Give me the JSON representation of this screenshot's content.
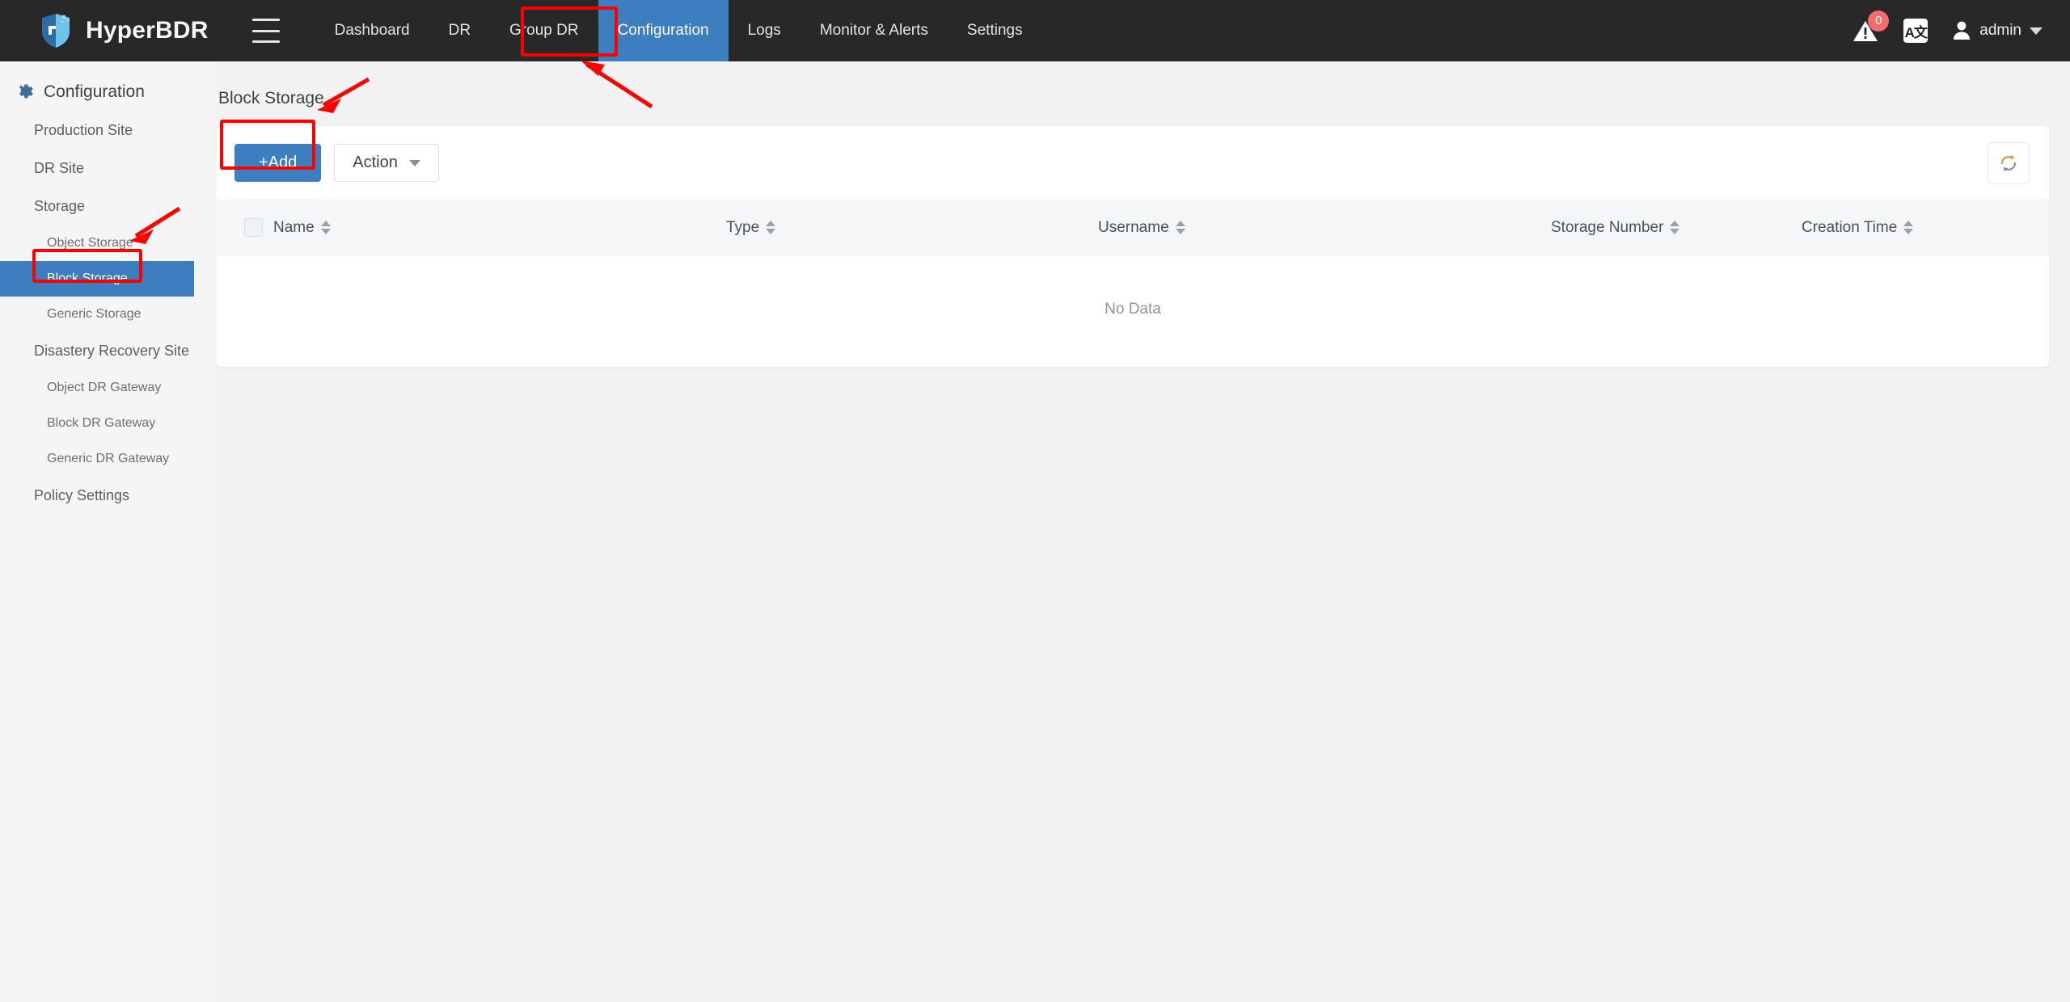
{
  "topbar": {
    "brand": "HyperBDR",
    "menu_icon": "hamburger-icon",
    "nav": [
      {
        "label": "Dashboard",
        "active": false
      },
      {
        "label": "DR",
        "active": false
      },
      {
        "label": "Group DR",
        "active": false
      },
      {
        "label": "Configuration",
        "active": true
      },
      {
        "label": "Logs",
        "active": false
      },
      {
        "label": "Monitor & Alerts",
        "active": false
      },
      {
        "label": "Settings",
        "active": false
      }
    ],
    "alert_badge": "0",
    "lang_label": "A文",
    "user": "admin"
  },
  "sidebar": {
    "heading": "Configuration",
    "items": [
      {
        "label": "Production Site",
        "level": 1,
        "active": false
      },
      {
        "label": "DR Site",
        "level": 1,
        "active": false
      },
      {
        "label": "Storage",
        "level": 1,
        "active": false
      },
      {
        "label": "Object Storage",
        "level": 2,
        "active": false
      },
      {
        "label": "Block Storage",
        "level": 2,
        "active": true
      },
      {
        "label": "Generic Storage",
        "level": 2,
        "active": false
      },
      {
        "label": "Disastery Recovery Site",
        "level": 1,
        "active": false
      },
      {
        "label": "Object DR Gateway",
        "level": 2,
        "active": false
      },
      {
        "label": "Block DR Gateway",
        "level": 2,
        "active": false
      },
      {
        "label": "Generic DR Gateway",
        "level": 2,
        "active": false
      },
      {
        "label": "Policy Settings",
        "level": 1,
        "active": false
      }
    ]
  },
  "main": {
    "page_title": "Block Storage",
    "toolbar": {
      "add_label": "+Add",
      "action_label": "Action",
      "refresh_icon": "refresh-icon"
    },
    "table": {
      "columns": [
        "Name",
        "Type",
        "Username",
        "Storage Number",
        "Creation Time"
      ],
      "rows": [],
      "empty_text": "No Data"
    }
  },
  "colors": {
    "topbar_bg": "#282828",
    "accent_blue": "#3c7ebf",
    "annotation_red": "#fe0000",
    "badge_red": "#f56c6c",
    "page_bg": "#f2f2f2"
  }
}
